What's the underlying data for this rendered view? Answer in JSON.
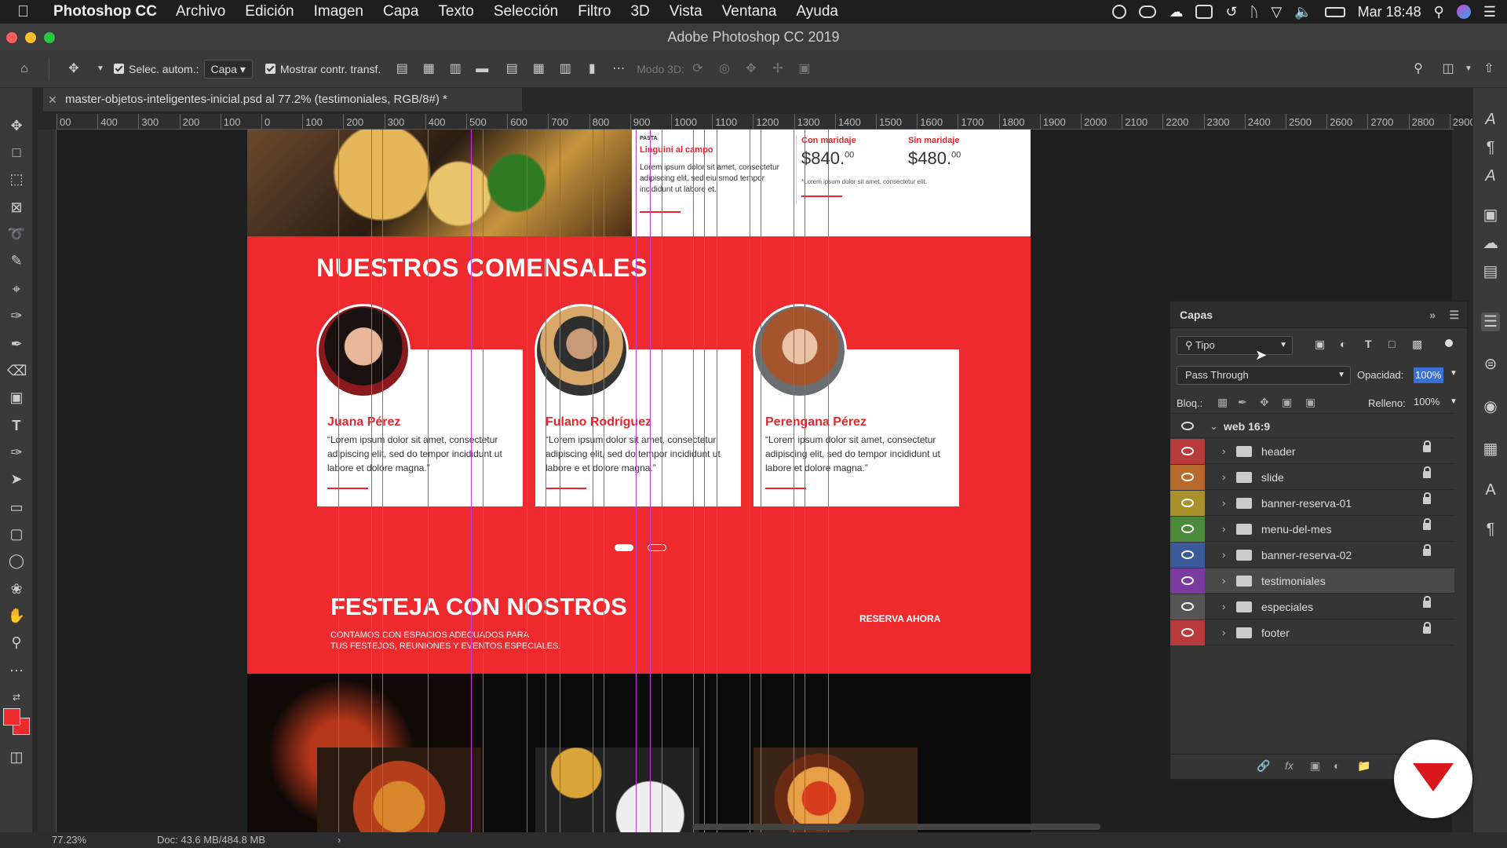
{
  "menubar": {
    "app": "Photoshop CC",
    "items": [
      "Archivo",
      "Edición",
      "Imagen",
      "Capa",
      "Texto",
      "Selección",
      "Filtro",
      "3D",
      "Vista",
      "Ventana",
      "Ayuda"
    ],
    "clock": "Mar 18:48"
  },
  "window": {
    "title": "Adobe Photoshop CC 2019"
  },
  "options": {
    "auto_select_label": "Selec. autom.:",
    "auto_select_value": "Capa",
    "show_transform_label": "Mostrar contr. transf.",
    "mode3d_label": "Modo 3D:"
  },
  "document": {
    "tab_title": "master-objetos-inteligentes-inicial.psd al 77.2% (testimoniales, RGB/8#) *",
    "menu": {
      "small_label": "PASTA",
      "dish": "Linguini al campo",
      "dish_desc": "Lorem ipsum dolor sit amet, consectetur adipiscing elit, sed eiu smod tempor incididunt ut labore et.",
      "with_pairing": "Con maridaje",
      "with_price": "$840.",
      "with_cents": "00",
      "without_pairing": "Sin maridaje",
      "without_price": "$480.",
      "without_cents": "00",
      "price_note": "*Lorem ipsum dolor sit amet, consectetur elit."
    },
    "testimonials_title": "NUESTROS COMENSALES",
    "testimonials": [
      {
        "name": "Juana Pérez",
        "quote": "“Lorem ipsum dolor sit amet, consectetur adipiscing elit, sed do  tempor incididunt ut labore et dolore magna.”"
      },
      {
        "name": "Fulano Rodríguez",
        "quote": "“Lorem ipsum dolor sit amet, consectetur adipiscing elit, sed do  tempor incididunt ut labore e et dolore magna.”"
      },
      {
        "name": "Perengana Pérez",
        "quote": "“Lorem ipsum dolor sit amet, consectetur adipiscing elit, sed do  tempor incididunt ut labore et dolore magna.”"
      }
    ],
    "events_title": "FESTEJA CON NOSTROS",
    "events_line1": "CONTAMOS CON ESPACIOS ADECUADOS PARA",
    "events_line2": "TUS FESTEJOS, REUNIONES Y EVENTOS ESPECIALES.",
    "reserve": "RESERVA AHORA"
  },
  "rulers": {
    "h": [
      "00",
      "400",
      "300",
      "200",
      "100",
      "0",
      "100",
      "200",
      "300",
      "400",
      "500",
      "600",
      "700",
      "800",
      "900",
      "1000",
      "1100",
      "1200",
      "1300",
      "1400",
      "1500",
      "1600",
      "1700",
      "1800",
      "1900",
      "2000",
      "2100",
      "2200",
      "2300",
      "2400",
      "2500",
      "2600",
      "2700",
      "2800",
      "2900"
    ]
  },
  "layers_panel": {
    "title": "Capas",
    "filter": "Tipo",
    "blend": "Pass Through",
    "opacity_label": "Opacidad:",
    "opacity": "100%",
    "lock_label": "Bloq.:",
    "fill_label": "Relleno:",
    "fill": "100%",
    "group": "web 16:9",
    "layers": [
      {
        "name": "header",
        "color": "#b83a3a"
      },
      {
        "name": "slide",
        "color": "#b86a2a"
      },
      {
        "name": "banner-reserva-01",
        "color": "#a8902a"
      },
      {
        "name": "menu-del-mes",
        "color": "#4a8a3a"
      },
      {
        "name": "banner-reserva-02",
        "color": "#3a5a9a"
      },
      {
        "name": "testimoniales",
        "color": "#7a3aa0"
      },
      {
        "name": "especiales",
        "color": "#555555"
      },
      {
        "name": "footer",
        "color": "#b83a3a"
      }
    ]
  },
  "status": {
    "zoom": "77.23%",
    "doc": "Doc: 43.6 MB/484.8 MB"
  }
}
